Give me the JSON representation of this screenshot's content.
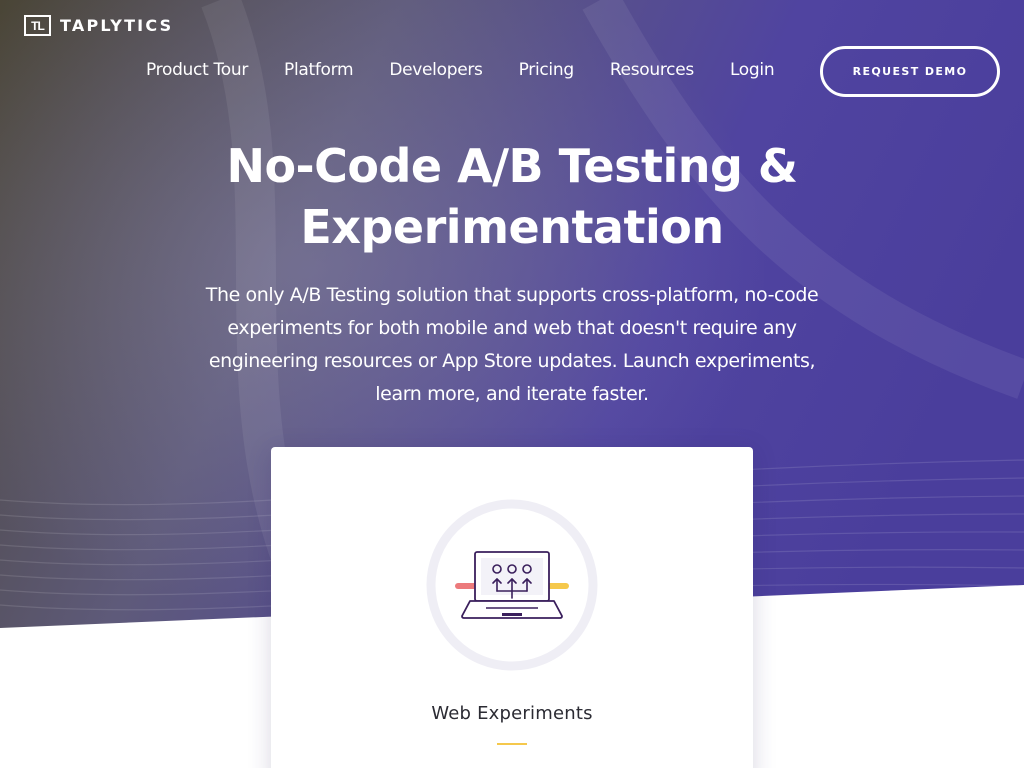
{
  "brand": {
    "logo_mark": "TL",
    "name": "TAPLYTICS"
  },
  "nav": {
    "items": [
      {
        "label": "Product Tour"
      },
      {
        "label": "Platform"
      },
      {
        "label": "Developers"
      },
      {
        "label": "Pricing"
      },
      {
        "label": "Resources"
      },
      {
        "label": "Login"
      }
    ],
    "cta_label": "REQUEST DEMO"
  },
  "hero": {
    "title_line1": "No-Code A/B Testing &",
    "title_line2": "Experimentation",
    "subtitle": "The only A/B Testing solution that supports cross-platform, no-code experiments for both mobile and web that doesn't require any engineering resources or App Store updates. Launch experiments, learn more, and iterate faster."
  },
  "card": {
    "icon": "laptop-experiment-icon",
    "title": "Web Experiments"
  },
  "colors": {
    "hero_left": "#4a4339",
    "hero_right": "#4b3fa0",
    "accent_yellow": "#f5c84c",
    "accent_red": "#ec7a7c",
    "icon_stroke": "#3a1f5c"
  }
}
